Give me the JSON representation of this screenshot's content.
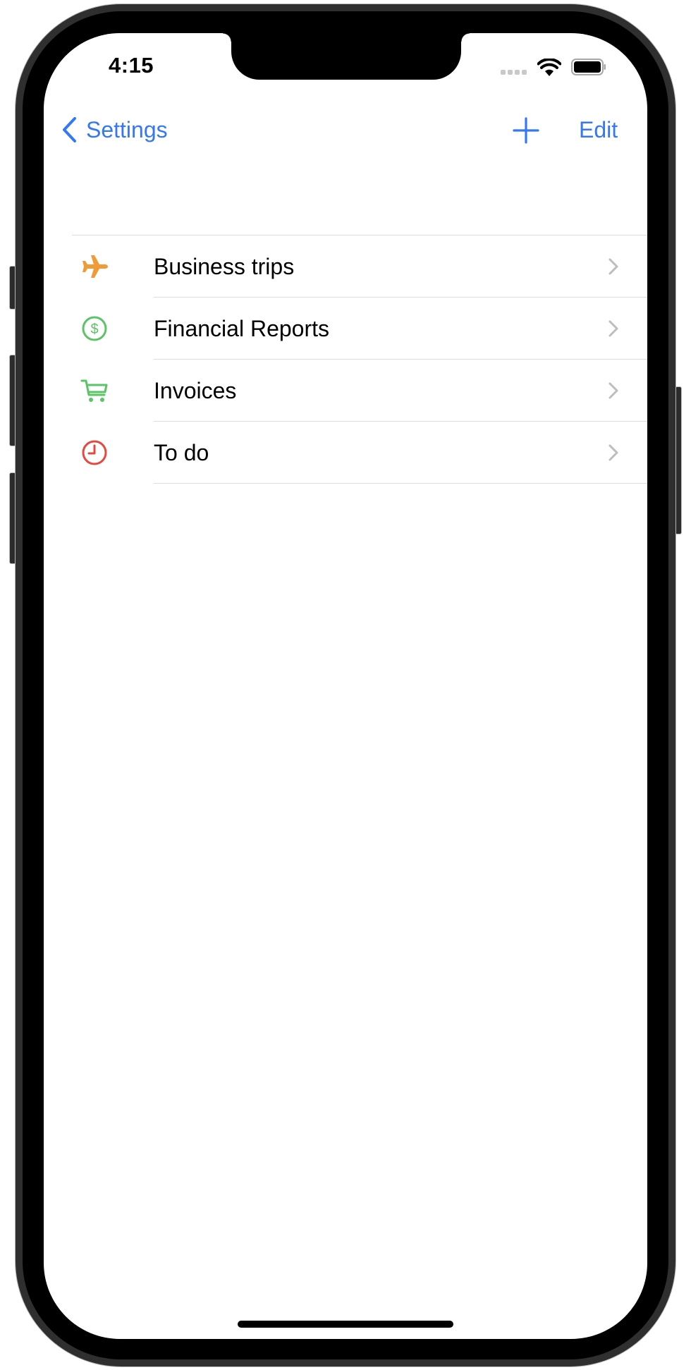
{
  "status_bar": {
    "time": "4:15",
    "signal_icon": "cellular-signal-icon",
    "wifi_icon": "wifi-icon",
    "battery_icon": "battery-icon"
  },
  "nav_bar": {
    "back_label": "Settings",
    "back_icon": "chevron-left-icon",
    "add_icon": "plus-icon",
    "edit_label": "Edit"
  },
  "list": {
    "items": [
      {
        "label": "Business trips",
        "icon": "airplane-icon",
        "icon_color": "#F19A38"
      },
      {
        "label": "Financial Reports",
        "icon": "dollar-circle-icon",
        "icon_color": "#5AC466"
      },
      {
        "label": "Invoices",
        "icon": "cart-icon",
        "icon_color": "#5AC466"
      },
      {
        "label": "To do",
        "icon": "clock-icon",
        "icon_color": "#E6483E"
      }
    ]
  },
  "colors": {
    "accent": "#3478F6",
    "separator": "#DCDCDC",
    "chevron": "#BDBDBD"
  }
}
